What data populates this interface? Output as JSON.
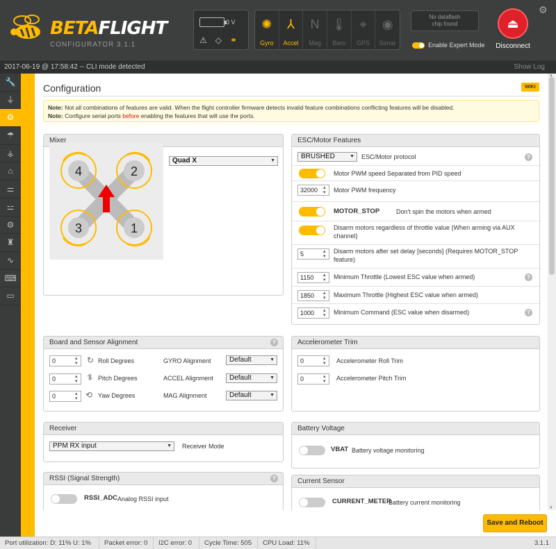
{
  "app": {
    "logo_main": "BETA",
    "logo_accent": "FLIGHT",
    "logo_sub": "CONFIGURATOR  3.1.1"
  },
  "header": {
    "battery_voltage": "0 V",
    "sensors": [
      {
        "label": "Gyro",
        "icon": "gyro-icon",
        "on": true
      },
      {
        "label": "Accel",
        "icon": "accel-icon",
        "on": true
      },
      {
        "label": "Mag",
        "icon": "mag-icon",
        "on": false
      },
      {
        "label": "Baro",
        "icon": "baro-icon",
        "on": false
      },
      {
        "label": "GPS",
        "icon": "gps-icon",
        "on": false
      },
      {
        "label": "Sonar",
        "icon": "sonar-icon",
        "on": false
      }
    ],
    "sensor_glyphs": {
      "gyro": "✺",
      "accel": "⅄",
      "mag": "N",
      "baro": "🌡",
      "gps": "⌖",
      "sonar": "◉"
    },
    "dataflash_line1": "No dataflash",
    "dataflash_line2": "chip found",
    "expert_mode_label": "Enable Expert Mode",
    "disconnect_label": "Disconnect"
  },
  "log": {
    "message": "2017-06-19 @ 17:58:42 -- CLI mode detected",
    "show_log": "Show Log"
  },
  "sidebar": {
    "tabs": [
      "setup",
      "ports",
      "configuration",
      "failsafe",
      "pid-tuning",
      "receiver",
      "modes",
      "adjustments",
      "servos",
      "motors",
      "sensors",
      "logging",
      "cli"
    ],
    "active": "configuration"
  },
  "page": {
    "title": "Configuration",
    "wiki": "WIKI",
    "note1_label": "Note:",
    "note1_text": " Not all combinations of features are valid. When the flight controller firmware detects invalid feature combinations conflicting features will be disabled.",
    "note2_label": "Note:",
    "note2_pre": " Configure serial ports ",
    "note2_red": "before",
    "note2_post": " enabling the features that will use the ports."
  },
  "mixer": {
    "title": "Mixer",
    "selected": "Quad X",
    "motors": [
      "4",
      "2",
      "3",
      "1"
    ]
  },
  "esc": {
    "title": "ESC/Motor Features",
    "protocol_value": "BRUSHED",
    "protocol_label": "ESC/Motor protocol",
    "pwm_separated_label": "Motor PWM speed Separated from PID speed",
    "pwm_freq_value": "32000",
    "pwm_freq_label": "Motor PWM frequency",
    "motor_stop_label": "MOTOR_STOP",
    "motor_stop_desc": "Don't spin the motors when armed",
    "disarm_label": "Disarm motors regardless of throttle value (When arming via AUX channel)",
    "disarm_delay_value": "5",
    "disarm_delay_label": "Disarm motors after set delay [seconds] (Requires MOTOR_STOP feature)",
    "min_throttle_value": "1150",
    "min_throttle_label": "Minimum Throttle (Lowest ESC value when armed)",
    "max_throttle_value": "1850",
    "max_throttle_label": "Maximum Throttle (Highest ESC value when armed)",
    "min_command_value": "1000",
    "min_command_label": "Minimum Command (ESC value when disarmed)"
  },
  "alignment": {
    "title": "Board and Sensor Alignment",
    "rows": [
      {
        "value": "0",
        "label": "Roll Degrees",
        "sensor_label": "GYRO Alignment",
        "sensor_value": "Default"
      },
      {
        "value": "0",
        "label": "Pitch Degrees",
        "sensor_label": "ACCEL Alignment",
        "sensor_value": "Default"
      },
      {
        "value": "0",
        "label": "Yaw Degrees",
        "sensor_label": "MAG Alignment",
        "sensor_value": "Default"
      }
    ]
  },
  "acc_trim": {
    "title": "Accelerometer Trim",
    "rows": [
      {
        "value": "0",
        "label": "Accelerometer Roll Trim"
      },
      {
        "value": "0",
        "label": "Accelerometer Pitch Trim"
      }
    ]
  },
  "receiver": {
    "title": "Receiver",
    "selected": "PPM RX input",
    "label": "Receiver Mode"
  },
  "battery": {
    "title": "Battery Voltage",
    "feature": "VBAT",
    "desc": "Battery voltage monitoring"
  },
  "rssi": {
    "title": "RSSI (Signal Strength)",
    "feature": "RSSI_ADC",
    "desc": "Analog RSSI input"
  },
  "current": {
    "title": "Current Sensor",
    "feature": "CURRENT_METER",
    "desc": "Battery current monitoring"
  },
  "save_button": "Save and Reboot",
  "status": {
    "port": "Port utilization: D: 11% U: 1%",
    "packet": "Packet error: 0",
    "i2c": "I2C error: 0",
    "cycle": "Cycle Time: 505",
    "cpu": "CPU Load: 11%",
    "version": "3.1.1"
  },
  "colors": {
    "accent": "#ffbb00",
    "header_bg": "#3d3f3e",
    "disconnect": "#e0202a"
  }
}
